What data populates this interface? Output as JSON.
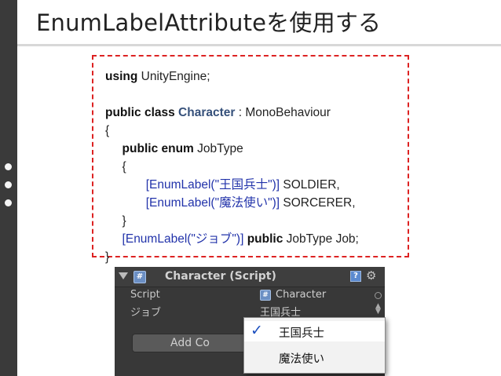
{
  "slide": {
    "title": "EnumLabelAttributeを使用する"
  },
  "code": {
    "line1_kw": "using",
    "line1_rest": " UnityEngine;",
    "line3_kw": "public class",
    "line3_type": "Character",
    "line3_rest": " : MonoBehaviour",
    "line4": "{",
    "line5_kw": "public enum",
    "line5_rest": " JobType",
    "line6": "{",
    "line7_attr": "[EnumLabel(\"王国兵士\")]",
    "line7_rest": " SOLDIER,",
    "line8_attr": "[EnumLabel(\"魔法使い\")]",
    "line8_rest": " SORCERER,",
    "line9": "}",
    "line10_attr": "[EnumLabel(\"ジョブ\")]",
    "line10_kw": "public",
    "line10_rest": " JobType Job;",
    "line11": "}"
  },
  "inspector": {
    "header_title": "Character (Script)",
    "script_label": "Script",
    "script_value": "Character",
    "job_label": "ジョブ",
    "job_value": "王国兵士",
    "add_button_label": "Add Co",
    "icons": {
      "foldout": "triangle-down-icon",
      "script": "script-file-icon",
      "help": "help-icon",
      "settings": "gear-icon",
      "object_picker": "circle-icon",
      "dropdown": "dropdown-arrows-icon"
    }
  },
  "dropdown": {
    "options": [
      {
        "label": "王国兵士",
        "selected": true
      },
      {
        "label": "魔法使い",
        "selected": false
      }
    ],
    "check_mark": "✓"
  },
  "colors": {
    "dashed_border": "#dd2222",
    "attribute_text": "#2233aa",
    "class_name": "#35507a",
    "side_bar": "#3a3a3a",
    "inspector_bg": "#383838",
    "check": "#1c4fbf"
  }
}
